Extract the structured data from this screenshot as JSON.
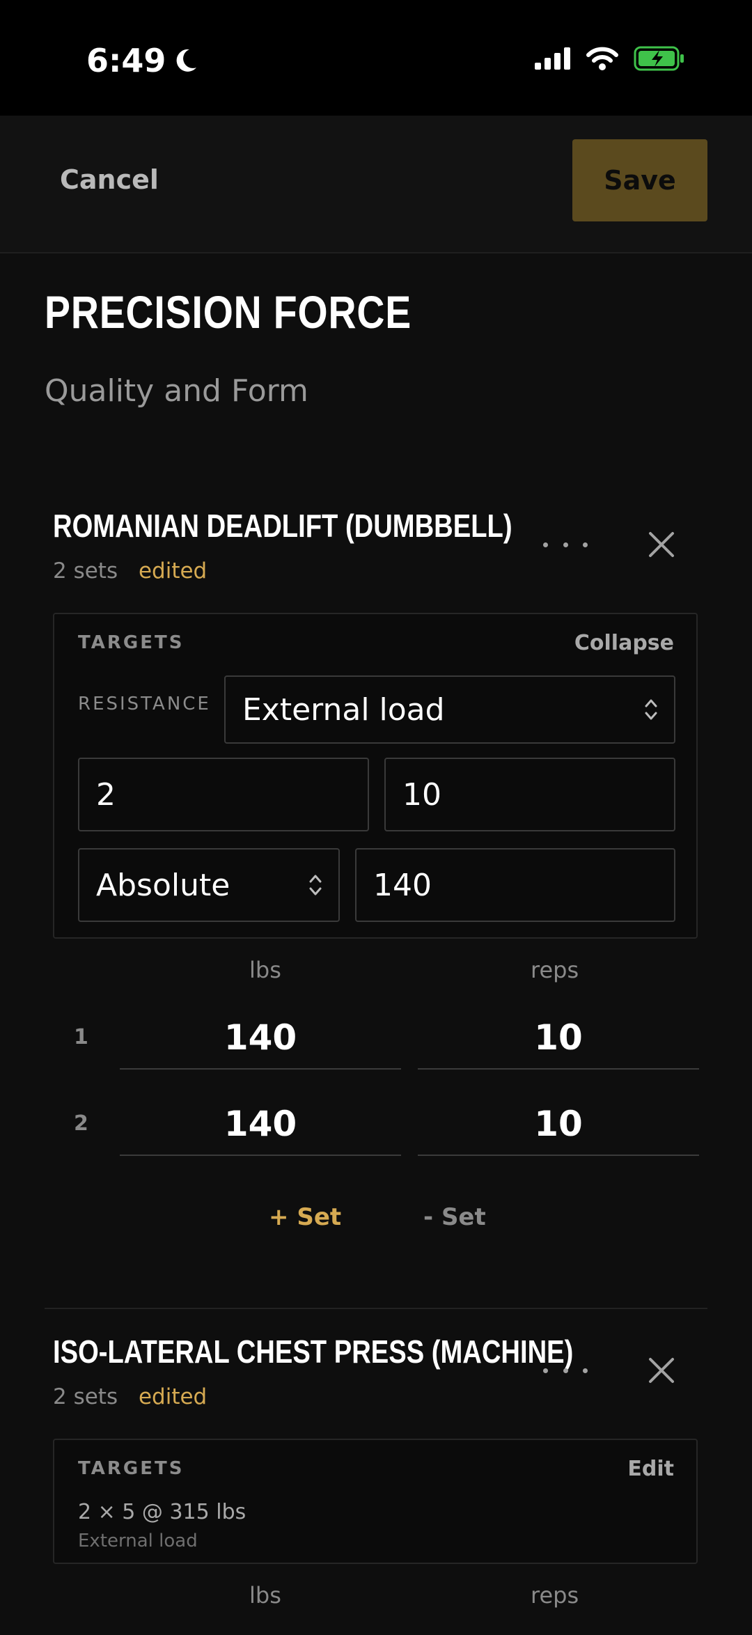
{
  "status": {
    "time": "6:49"
  },
  "header": {
    "cancel_label": "Cancel",
    "save_label": "Save"
  },
  "workout": {
    "title": "PRECISION FORCE",
    "subtitle": "Quality and Form"
  },
  "exercises": [
    {
      "name": "ROMANIAN DEADLIFT (DUMBBELL)",
      "sets_count": "2 sets",
      "edited_label": "edited",
      "targets": {
        "label": "TARGETS",
        "action": "Collapse",
        "resistance_label": "RESISTANCE",
        "resistance_value": "External load",
        "sets_value": "2",
        "reps_value": "10",
        "mode_value": "Absolute",
        "load_value": "140"
      },
      "columns": {
        "weight": "lbs",
        "reps": "reps"
      },
      "sets": [
        {
          "num": "1",
          "weight": "140",
          "reps": "10"
        },
        {
          "num": "2",
          "weight": "140",
          "reps": "10"
        }
      ],
      "add_set_label": "+ Set",
      "remove_set_label": "- Set"
    },
    {
      "name": "ISO-LATERAL CHEST PRESS (MACHINE)",
      "sets_count": "2 sets",
      "edited_label": "edited",
      "targets": {
        "label": "TARGETS",
        "action": "Edit",
        "summary": "2 × 5 @ 315 lbs",
        "summary_sub": "External load"
      },
      "columns": {
        "weight": "lbs",
        "reps": "reps"
      }
    }
  ],
  "colors": {
    "accent": "#d6aa52",
    "save_bg": "#5b4a1e",
    "background": "#0e0e0e",
    "battery": "#3fc24a"
  }
}
